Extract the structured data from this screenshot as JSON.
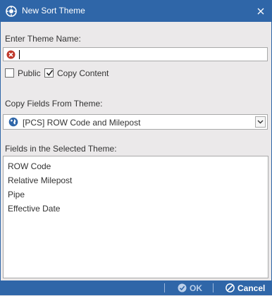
{
  "window": {
    "title": "New Sort Theme"
  },
  "form": {
    "theme_name_label": "Enter Theme Name:",
    "theme_name_value": "",
    "public_label": "Public",
    "public_checked": false,
    "copy_content_label": "Copy Content",
    "copy_content_checked": true,
    "copy_fields_label": "Copy Fields From Theme:",
    "copy_fields_selected": "[PCS] ROW Code and Milepost",
    "fields_label": "Fields in the Selected Theme:",
    "fields": [
      "ROW Code",
      "Relative Milepost",
      "Pipe",
      "Effective Date"
    ]
  },
  "footer": {
    "ok_label": "OK",
    "cancel_label": "Cancel"
  },
  "colors": {
    "accent": "#2f66a8",
    "error": "#c0392b",
    "background": "#ebe9ea"
  }
}
